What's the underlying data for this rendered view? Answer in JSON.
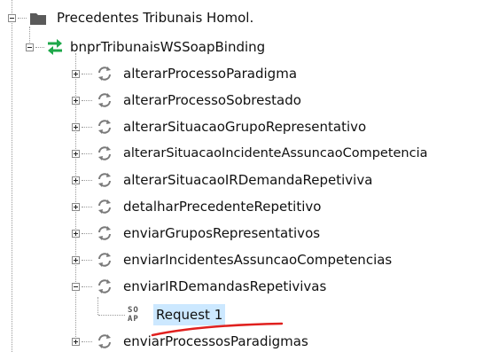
{
  "tree": {
    "project": {
      "label": "Precedentes Tribunais Homol.",
      "icon": "folder-icon",
      "expanded": true
    },
    "binding": {
      "label": "bnprTribunaisWSSoapBinding",
      "icon": "interface-arrows-icon",
      "icon_color": "#1ea84a",
      "expanded": true
    },
    "operations": [
      {
        "label": "alterarProcessoParadigma",
        "expanded": false
      },
      {
        "label": "alterarProcessoSobrestado",
        "expanded": false
      },
      {
        "label": "alterarSituacaoGrupoRepresentativo",
        "expanded": false
      },
      {
        "label": "alterarSituacaoIncidenteAssuncaoCompetencia",
        "expanded": false
      },
      {
        "label": "alterarSituacaoIRDemandaRepetiviva",
        "expanded": false
      },
      {
        "label": "detalharPrecedenteRepetitivo",
        "expanded": false
      },
      {
        "label": "enviarGruposRepresentativos",
        "expanded": false
      },
      {
        "label": "enviarIncidentesAssuncaoCompetencias",
        "expanded": false
      },
      {
        "label": "enviarIRDemandasRepetivivas",
        "expanded": true
      },
      {
        "label": "enviarProcessosParadigmas",
        "expanded": false
      }
    ],
    "request": {
      "label": "Request 1",
      "badge_top": "SO",
      "badge_bottom": "AP",
      "selected": true
    },
    "annotation_color": "#e0201e",
    "selection_color": "#cce8ff"
  }
}
